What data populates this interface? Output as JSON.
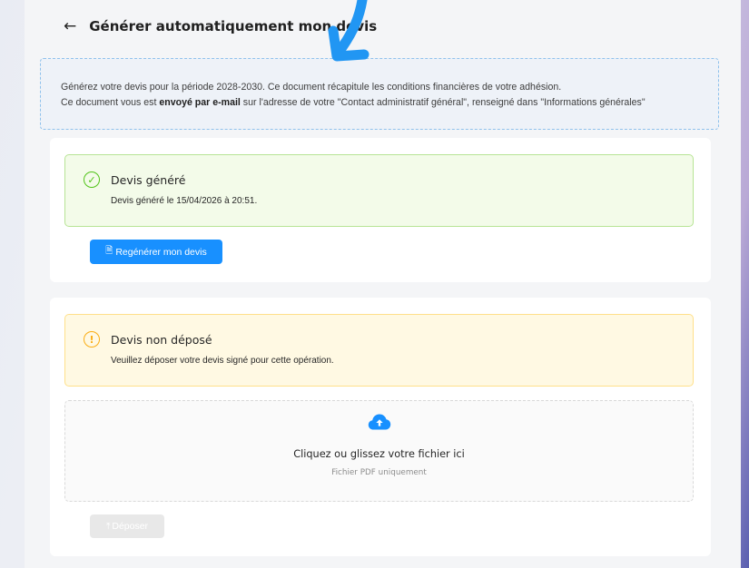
{
  "header": {
    "back_icon": "arrow-left-icon",
    "title": "Générer automatiquement mon devis"
  },
  "info": {
    "line1": "Générez votre devis pour la période 2028-2030. Ce document récapitule les conditions financières de votre adhésion.",
    "line2_prefix": "Ce document vous est ",
    "line2_bold": "envoyé par e-mail",
    "line2_suffix": " sur l'adresse de votre \"Contact administratif général\", renseigné dans \"Informations générales\""
  },
  "generated_card": {
    "status_icon": "check-circle-icon",
    "status_title": "Devis généré",
    "status_desc": "Devis généré le 15/04/2026 à 20:51.",
    "button_icon": "file-icon",
    "button_label": "Regénérer mon devis"
  },
  "upload_card": {
    "status_icon": "exclamation-circle-icon",
    "status_title": "Devis non déposé",
    "status_desc": "Veuillez déposer votre devis signé pour cette opération.",
    "dropzone_icon": "cloud-upload-icon",
    "dropzone_text": "Cliquez ou glissez votre fichier ici",
    "dropzone_hint": "Fichier PDF uniquement",
    "submit_icon": "upload-icon",
    "submit_label": "Déposer",
    "submit_disabled": true
  },
  "colors": {
    "primary": "#1890ff",
    "success": "#52c41a",
    "warning": "#faad14",
    "annotation_arrow": "#2196f3"
  }
}
